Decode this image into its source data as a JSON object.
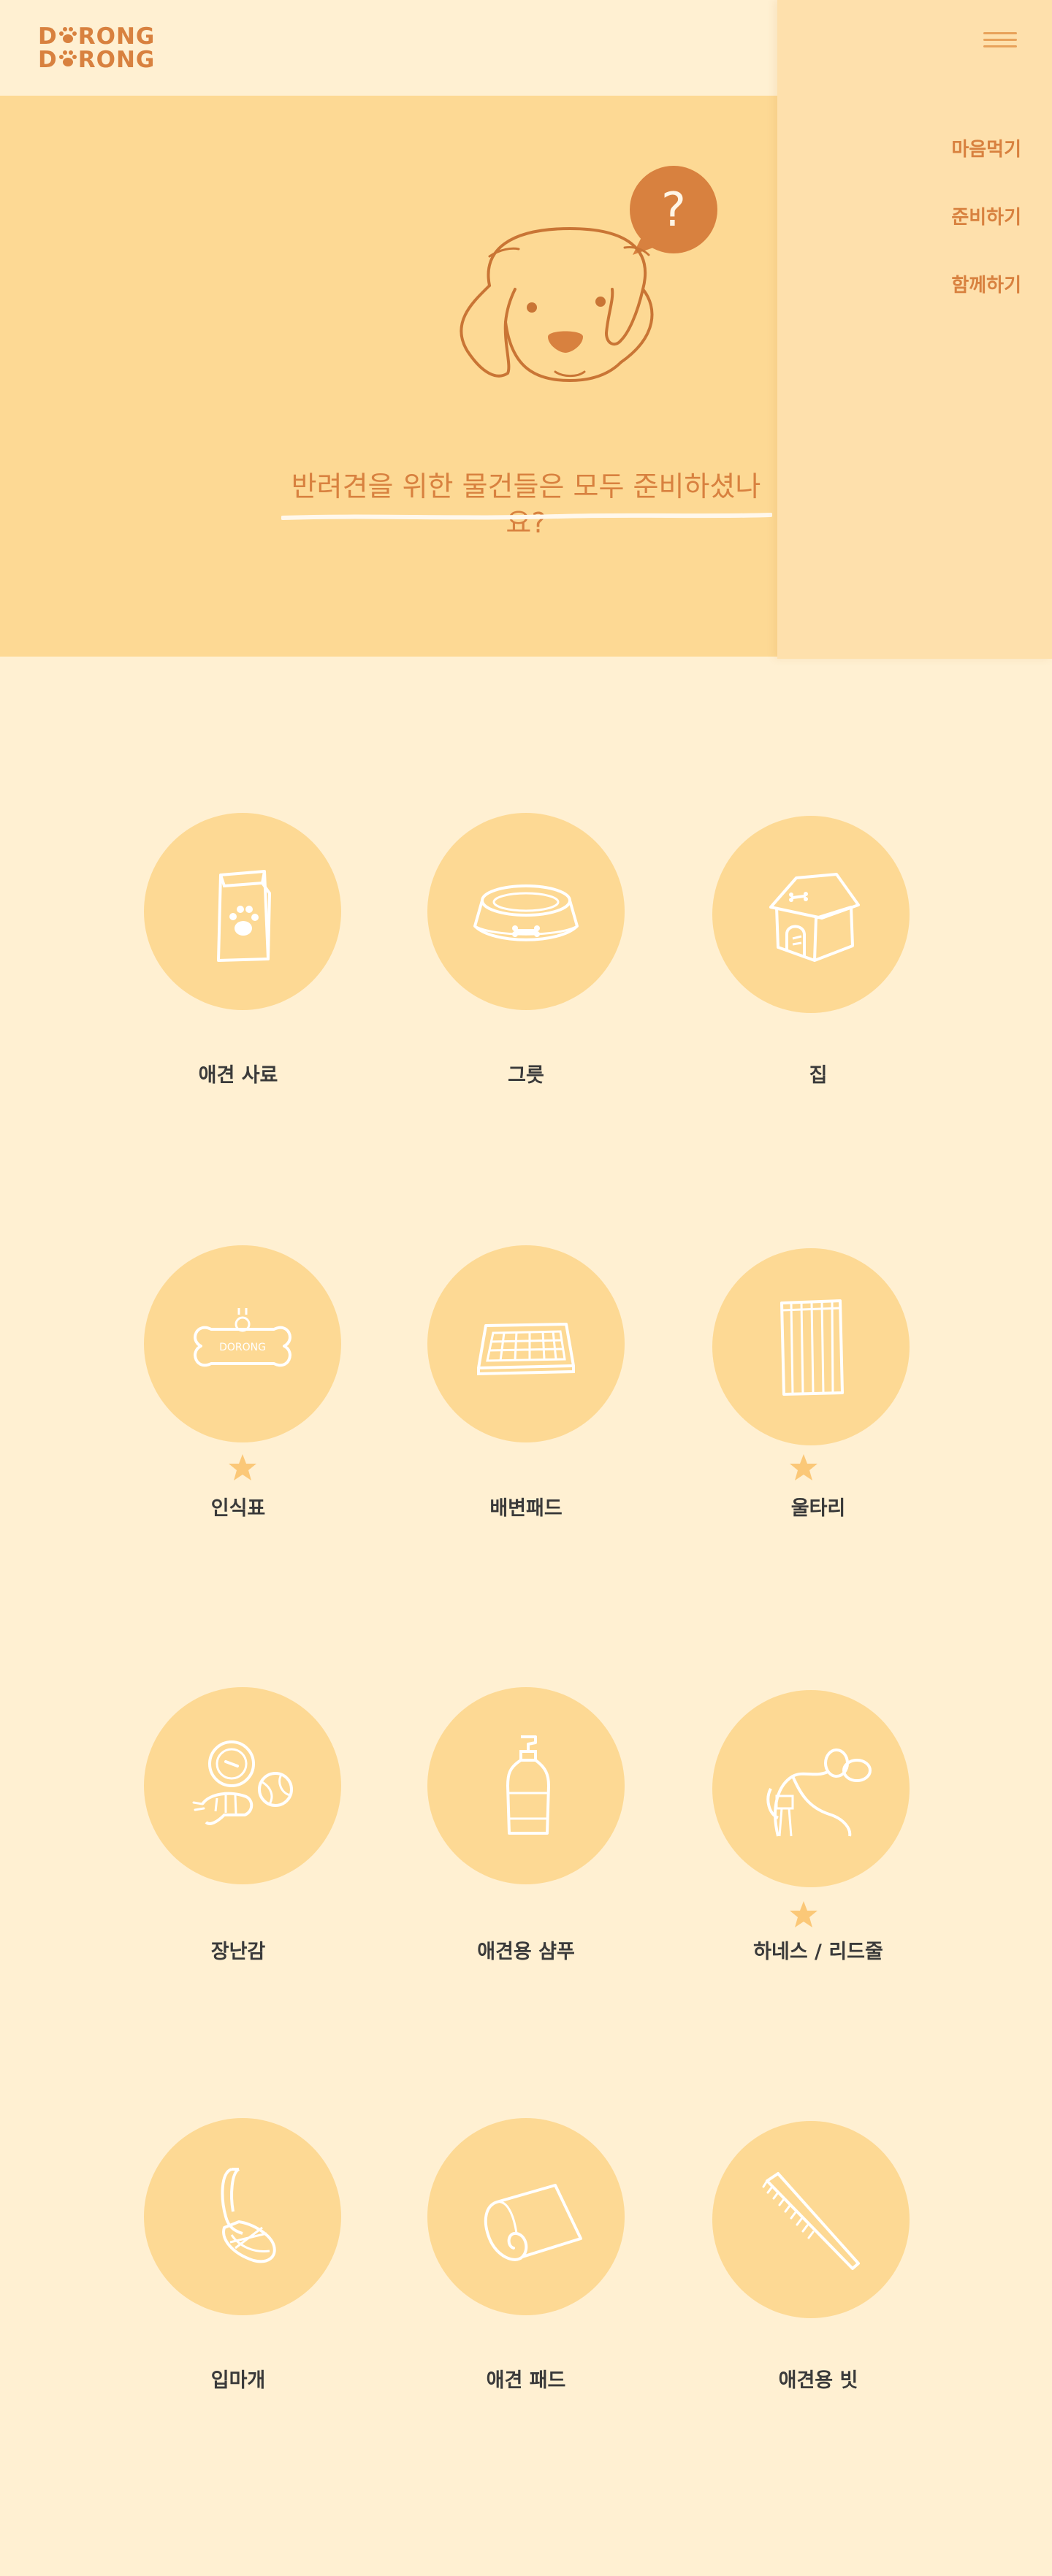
{
  "header": {
    "logo_line1": "D​RONG",
    "logo_line2": "D​RONG",
    "logo_text": "DORONG DORONG"
  },
  "hero": {
    "title": "반려견을 위한 물건들은 모두 준비하셨나요?",
    "bubble": "?"
  },
  "nav": {
    "items": [
      {
        "label": "마음먹기"
      },
      {
        "label": "준비하기"
      },
      {
        "label": "함께하기"
      }
    ]
  },
  "tag_text": "DORONG",
  "items": [
    {
      "label": "애견 사료",
      "icon": "food-bag-icon",
      "starred": false
    },
    {
      "label": "그릇",
      "icon": "bowl-icon",
      "starred": false
    },
    {
      "label": "집",
      "icon": "dog-house-icon",
      "starred": false
    },
    {
      "label": "인식표",
      "icon": "bone-tag-icon",
      "starred": true
    },
    {
      "label": "배변패드",
      "icon": "potty-pad-icon",
      "starred": false
    },
    {
      "label": "울타리",
      "icon": "fence-icon",
      "starred": true
    },
    {
      "label": "장난감",
      "icon": "toys-icon",
      "starred": false
    },
    {
      "label": "애견용 샴푸",
      "icon": "shampoo-icon",
      "starred": false
    },
    {
      "label": "하네스 / 리드줄",
      "icon": "harness-icon",
      "starred": true
    },
    {
      "label": "입마개",
      "icon": "muzzle-icon",
      "starred": false
    },
    {
      "label": "애견 패드",
      "icon": "rolled-pad-icon",
      "starred": false
    },
    {
      "label": "애견용 빗",
      "icon": "comb-icon",
      "starred": false
    }
  ],
  "colors": {
    "background": "#FFF0D2",
    "hero": "#FDD994",
    "panel": "#FEE0AC",
    "accent": "#D8813F",
    "star": "#FBC878"
  }
}
